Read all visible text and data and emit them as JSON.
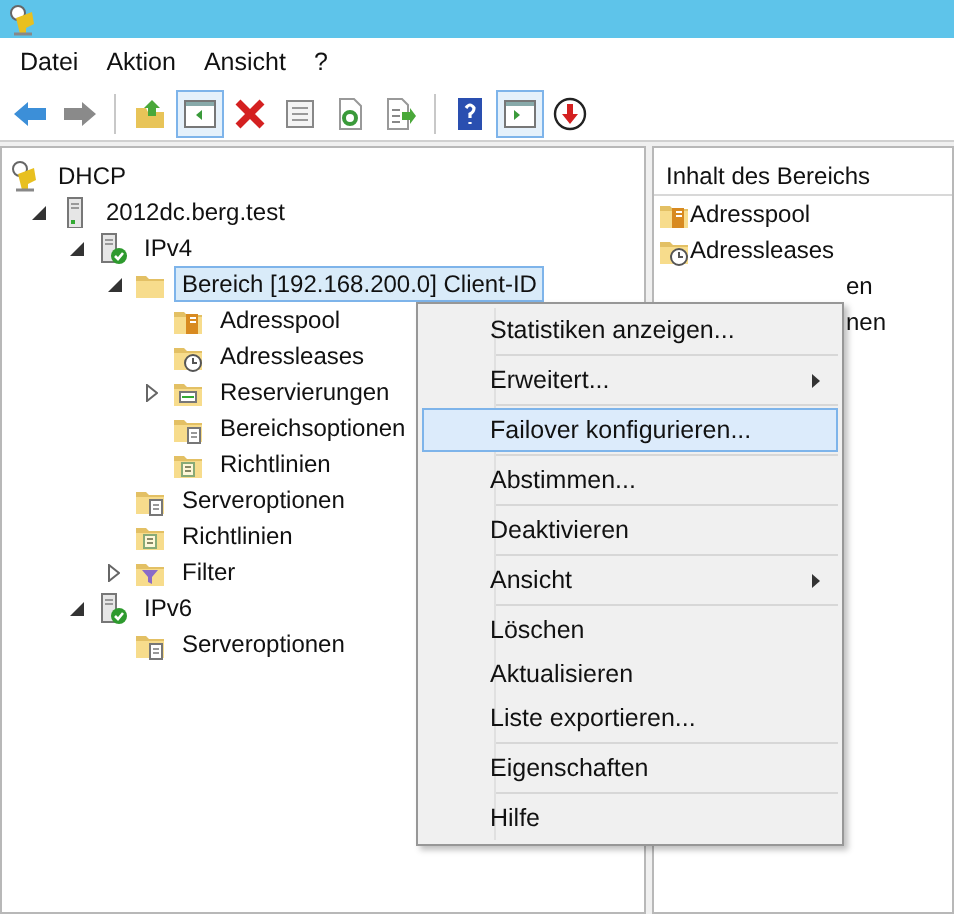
{
  "menubar": [
    {
      "label": "Datei"
    },
    {
      "label": "Aktion"
    },
    {
      "label": "Ansicht"
    },
    {
      "label": "?"
    }
  ],
  "toolbar": [
    {
      "kind": "back",
      "pressed": false
    },
    {
      "kind": "forward",
      "pressed": false
    },
    {
      "kind": "sep"
    },
    {
      "kind": "up",
      "pressed": false
    },
    {
      "kind": "pane",
      "pressed": true
    },
    {
      "kind": "delete",
      "pressed": false
    },
    {
      "kind": "props",
      "pressed": false
    },
    {
      "kind": "refresh",
      "pressed": false
    },
    {
      "kind": "export",
      "pressed": false
    },
    {
      "kind": "sep"
    },
    {
      "kind": "help",
      "pressed": false
    },
    {
      "kind": "pane2",
      "pressed": true
    },
    {
      "kind": "down",
      "pressed": false
    }
  ],
  "tree": [
    {
      "label": "DHCP",
      "kind": "dhcp",
      "selected": false,
      "children": [
        {
          "label": "2012dc.berg.test",
          "kind": "server",
          "expanded": true,
          "selected": false,
          "children": [
            {
              "label": "IPv4",
              "kind": "ip",
              "expanded": true,
              "selected": false,
              "children": [
                {
                  "label": "Bereich [192.168.200.0] Client-ID",
                  "kind": "folder",
                  "expanded": true,
                  "selected": true,
                  "children": [
                    {
                      "label": "Adresspool",
                      "kind": "pool",
                      "selected": false
                    },
                    {
                      "label": "Adressleases",
                      "kind": "leases",
                      "selected": false
                    },
                    {
                      "label": "Reservierungen",
                      "kind": "res",
                      "expanded": false,
                      "selected": false
                    },
                    {
                      "label": "Bereichsoptionen",
                      "kind": "opts",
                      "selected": false
                    },
                    {
                      "label": "Richtlinien",
                      "kind": "policy",
                      "selected": false
                    }
                  ]
                },
                {
                  "label": "Serveroptionen",
                  "kind": "opts",
                  "selected": false
                },
                {
                  "label": "Richtlinien",
                  "kind": "policy",
                  "selected": false
                },
                {
                  "label": "Filter",
                  "kind": "filter",
                  "expanded": false,
                  "selected": false
                }
              ]
            },
            {
              "label": "IPv6",
              "kind": "ip",
              "expanded": true,
              "selected": false,
              "children": [
                {
                  "label": "Serveroptionen",
                  "kind": "opts",
                  "selected": false
                }
              ]
            }
          ]
        }
      ]
    }
  ],
  "content": {
    "header": "Inhalt des Bereichs",
    "items": [
      {
        "label": "Adresspool",
        "kind": "pool"
      },
      {
        "label": "Adressleases",
        "kind": "leases"
      },
      {
        "label": "en",
        "kind": "covered"
      },
      {
        "label": "nen",
        "kind": "covered"
      }
    ]
  },
  "context_menu": {
    "groups": [
      [
        {
          "label": "Statistiken anzeigen...",
          "submenu": false,
          "selected": false
        }
      ],
      [
        {
          "label": "Erweitert...",
          "submenu": true,
          "selected": false
        }
      ],
      [
        {
          "label": "Failover konfigurieren...",
          "submenu": false,
          "selected": true
        }
      ],
      [
        {
          "label": "Abstimmen...",
          "submenu": false,
          "selected": false
        }
      ],
      [
        {
          "label": "Deaktivieren",
          "submenu": false,
          "selected": false
        }
      ],
      [
        {
          "label": "Ansicht",
          "submenu": true,
          "selected": false
        }
      ],
      [
        {
          "label": "Löschen",
          "submenu": false,
          "selected": false
        },
        {
          "label": "Aktualisieren",
          "submenu": false,
          "selected": false
        },
        {
          "label": "Liste exportieren...",
          "submenu": false,
          "selected": false
        }
      ],
      [
        {
          "label": "Eigenschaften",
          "submenu": false,
          "selected": false
        }
      ],
      [
        {
          "label": "Hilfe",
          "submenu": false,
          "selected": false
        }
      ]
    ]
  }
}
